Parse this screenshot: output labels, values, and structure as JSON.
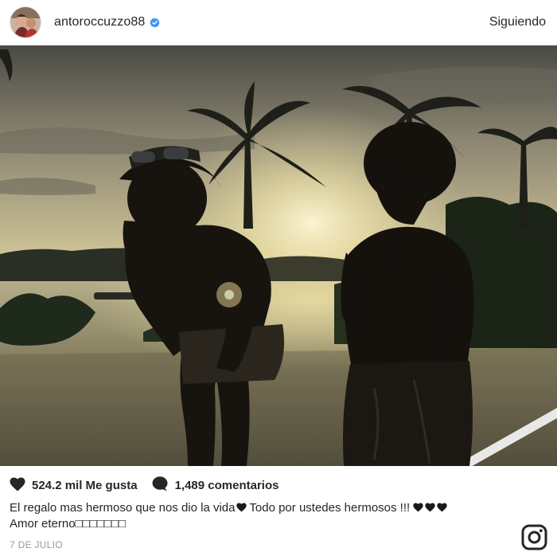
{
  "header": {
    "username": "antoroccuzzo88",
    "follow_label": "Siguiendo",
    "avatar_icon": "profile-avatar",
    "verified_icon": "verified-badge-icon",
    "verified_color": "#3897f0"
  },
  "stats": {
    "likes": "524.2 mil Me gusta",
    "comments": "1,489 comentarios",
    "like_icon": "heart-icon",
    "comment_icon": "speech-bubble-icon"
  },
  "caption": {
    "line1_part1": "El regalo mas hermoso que nos dio la vida",
    "line1_part2": " Todo por ustedes hermosos !!! ",
    "line2": "Amor eterno□□□□□□□"
  },
  "date": "7 DE JULIO",
  "footer": {
    "logo_icon": "instagram-logo-icon"
  }
}
